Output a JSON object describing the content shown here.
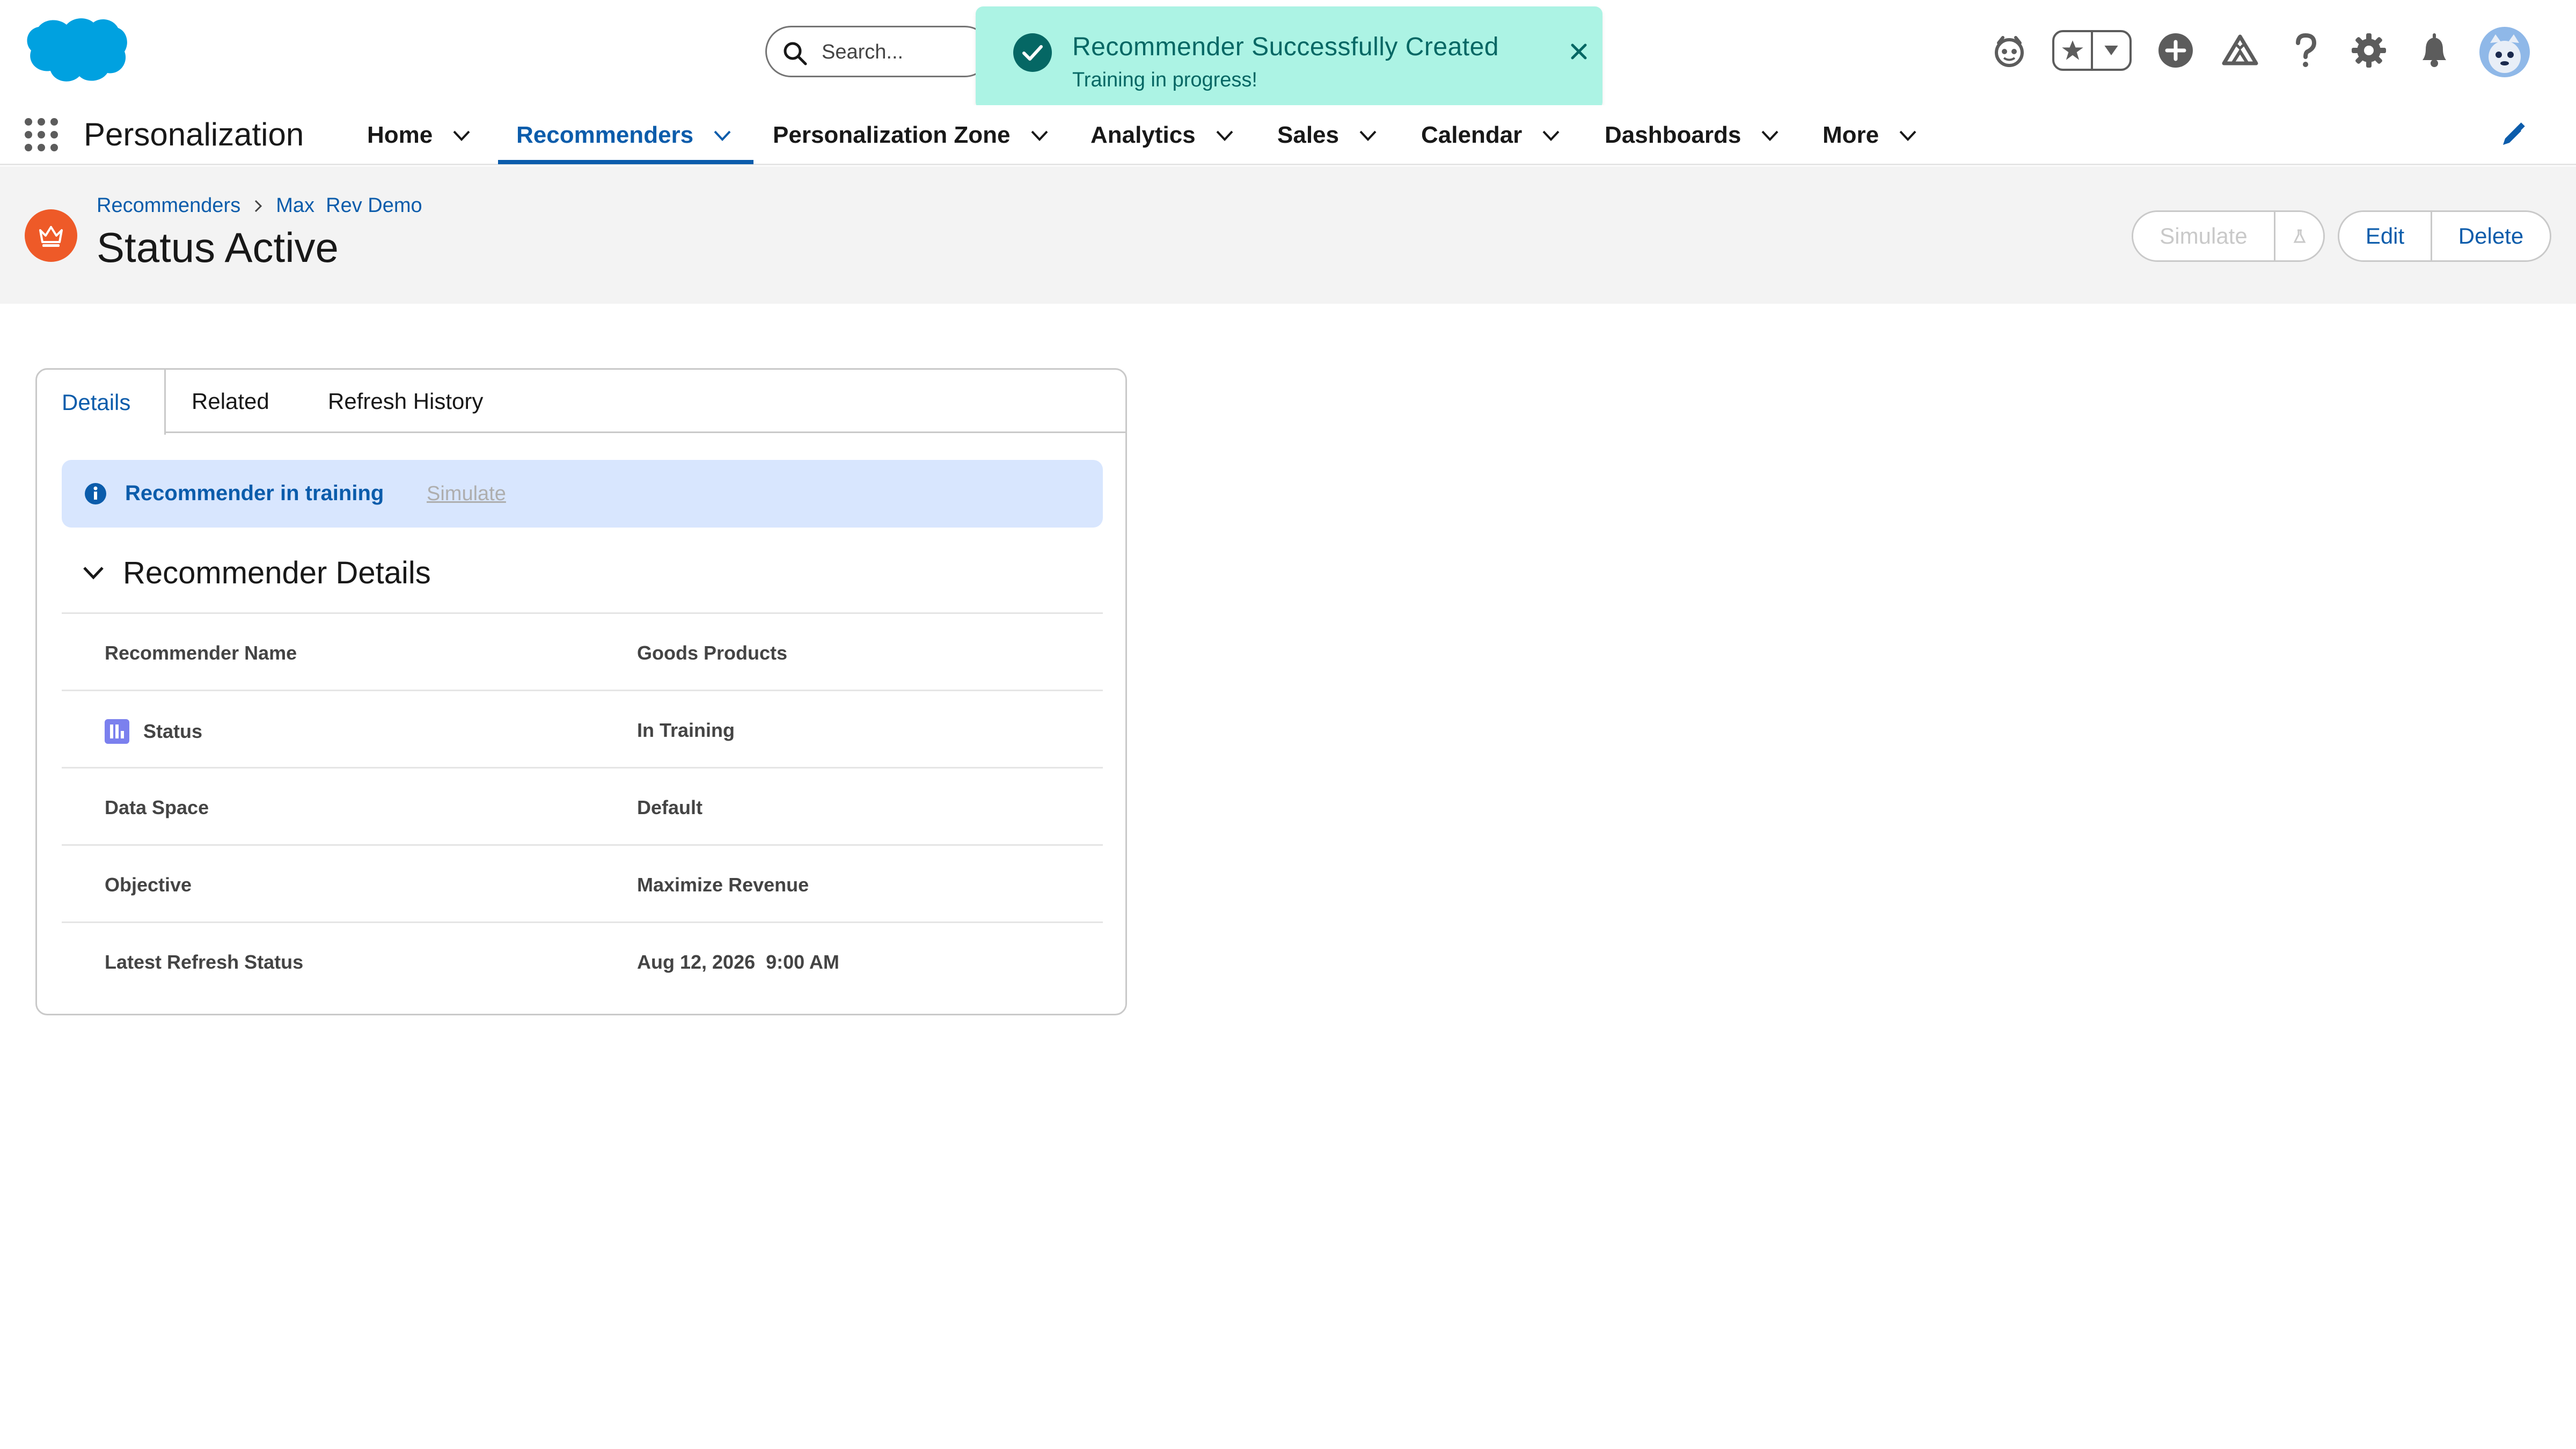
{
  "header": {
    "search_placeholder": "Search...",
    "icons": [
      "einstein-icon",
      "favorites-star-icon",
      "favorites-dropdown-icon",
      "global-actions-add-icon",
      "trailhead-icon",
      "help-icon",
      "setup-gear-icon",
      "notifications-bell-icon",
      "user-avatar"
    ]
  },
  "toast": {
    "title": "Recommender Successfully Created",
    "message": "Training in progress!",
    "color": "#acf3e4"
  },
  "nav": {
    "app_name": "Personalization",
    "items": [
      {
        "label": "Home"
      },
      {
        "label": "Recommenders"
      },
      {
        "label": "Personalization Zone"
      },
      {
        "label": "Analytics"
      },
      {
        "label": "Sales"
      },
      {
        "label": "Calendar"
      },
      {
        "label": "Dashboards"
      },
      {
        "label": "More"
      }
    ],
    "active": "Recommenders",
    "accent": "#0b5cab"
  },
  "page_header": {
    "breadcrumb": [
      "Recommenders",
      "Max  Rev Demo"
    ],
    "title": "Status Active",
    "buttons": {
      "simulate": "Simulate",
      "edit": "Edit",
      "delete": "Delete"
    }
  },
  "card": {
    "tabs": [
      "Details",
      "Related",
      "Refresh History"
    ],
    "active_tab": "Details",
    "banner": {
      "text": "Recommender in training",
      "link": "Simulate"
    },
    "section_title": "Recommender Details",
    "fields": [
      {
        "label": "Recommender Name",
        "value": "Goods Products"
      },
      {
        "label": "Status",
        "value": "In Training"
      },
      {
        "label": "Data Space",
        "value": "Default"
      },
      {
        "label": "Objective",
        "value": "Maximize Revenue"
      },
      {
        "label": "Latest Refresh Status",
        "value": "Aug 12, 2026  9:00 AM"
      }
    ]
  }
}
